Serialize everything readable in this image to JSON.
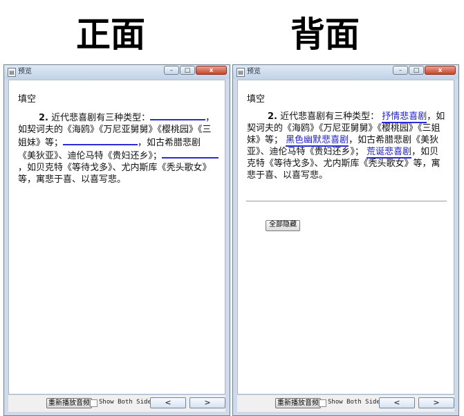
{
  "headings": {
    "front": "正面",
    "back": "背面"
  },
  "window_title": "预览",
  "window_controls": {
    "minimize": "–",
    "maximize": "□",
    "close": "x"
  },
  "section_label": "填空",
  "question": {
    "number": "2.",
    "prompt": "近代悲喜剧有三种类型：",
    "s1": "，如契诃夫的《海鸥》《万尼亚舅舅》《樱桃园》《三姐妹》等；",
    "s2": "，如古希腊悲剧《美狄亚》、迪伦马特《贵妇还乡》；",
    "s3": "，如贝克特《等待戈多》、尤内斯库《秃头歌女》等，寓悲于喜、以喜写悲。",
    "answers": [
      "抒情悲喜剧",
      "黑色幽默悲喜剧",
      "荒诞悲喜剧"
    ]
  },
  "hide_all_button": "全部隐藏",
  "bottom_bar": {
    "replay_button": "重新播放音频",
    "show_both_sides": "Show Both Sides",
    "prev": "<",
    "next": ">"
  }
}
